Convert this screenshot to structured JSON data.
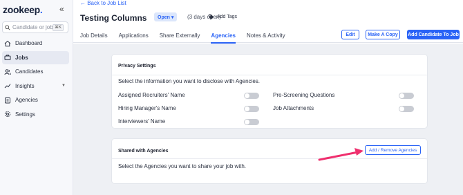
{
  "app": {
    "logo_text": "zookeep",
    "logo_dot": ".",
    "collapse_glyph": "«"
  },
  "search": {
    "placeholder": "Candidate or job",
    "shortcut": "⌘K"
  },
  "sidebar": {
    "items": [
      {
        "label": "Dashboard",
        "icon": "home-icon"
      },
      {
        "label": "Jobs",
        "icon": "briefcase-icon",
        "active": true
      },
      {
        "label": "Candidates",
        "icon": "users-icon"
      },
      {
        "label": "Insights",
        "icon": "chart-icon",
        "has_chevron": true
      },
      {
        "label": "Agencies",
        "icon": "agency-icon"
      },
      {
        "label": "Settings",
        "icon": "gear-icon"
      }
    ]
  },
  "header": {
    "back_label": "← Back to Job List",
    "job_title": "Testing Columns",
    "status": "Open ▾",
    "days_open": "(3 days open)",
    "add_tags": "Add Tags",
    "tabs": [
      "Job Details",
      "Applications",
      "Share Externally",
      "Agencies",
      "Notes & Activity"
    ],
    "active_tab": "Agencies",
    "buttons": {
      "edit": "Edit",
      "copy": "Make A Copy",
      "add_candidate": "Add Candidate To Job"
    }
  },
  "privacy": {
    "title": "Privacy Settings",
    "subtitle": "Select the information you want to disclose with Agencies.",
    "options": [
      {
        "label": "Assigned Recruiters' Name",
        "enabled": false
      },
      {
        "label": "Pre-Screening Questions",
        "enabled": false
      },
      {
        "label": "Hiring Manager's Name",
        "enabled": false
      },
      {
        "label": "Job Attachments",
        "enabled": false
      },
      {
        "label": "Interviewers' Name",
        "enabled": false
      }
    ]
  },
  "shared": {
    "title": "Shared with Agencies",
    "button": "Add / Remove Agencies",
    "subtitle": "Select the Agencies you want to share your job with."
  },
  "colors": {
    "accent": "#2a63f6",
    "arrow": "#ef2f6e",
    "toggle_off": "#c9ccd3"
  }
}
